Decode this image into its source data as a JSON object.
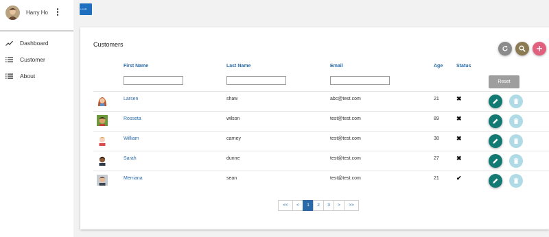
{
  "sidebar": {
    "user_name": "Harry Ho",
    "items": [
      {
        "label": "Dashboard",
        "icon": "trending-up-icon"
      },
      {
        "label": "Customer",
        "icon": "list-icon"
      },
      {
        "label": "About",
        "icon": "list-icon"
      }
    ]
  },
  "logo_text": "e-vendor",
  "card": {
    "title": "Customers",
    "actions": [
      {
        "name": "refresh-button",
        "icon": "refresh-icon",
        "color": "#8a8a8a"
      },
      {
        "name": "search-button",
        "icon": "search-icon",
        "color": "#8c7a52"
      },
      {
        "name": "add-button",
        "icon": "plus-icon",
        "color": "#e0607e"
      }
    ]
  },
  "table": {
    "columns": [
      "First Name",
      "Last Name",
      "Email",
      "Age",
      "Status"
    ],
    "reset_label": "Reset",
    "rows": [
      {
        "first_name": "Larsen",
        "last_name": "shaw",
        "email": "abc@test.com",
        "age": "21",
        "status": "✖"
      },
      {
        "first_name": "Rosseta",
        "last_name": "wilson",
        "email": "test@test.com",
        "age": "89",
        "status": "✖"
      },
      {
        "first_name": "William",
        "last_name": "carney",
        "email": "test@test.com",
        "age": "38",
        "status": "✖"
      },
      {
        "first_name": "Sarah",
        "last_name": "dunne",
        "email": "test@test.com",
        "age": "27",
        "status": "✖"
      },
      {
        "first_name": "Merriana",
        "last_name": "sean",
        "email": "test@test.com",
        "age": "21",
        "status": "✔"
      }
    ]
  },
  "pagination": {
    "first": "<<",
    "prev": "<",
    "pages": [
      "1",
      "2",
      "3"
    ],
    "current": "1",
    "next": ">",
    "last": ">>"
  },
  "colors": {
    "accent": "#2a6aa8",
    "edit": "#127a72",
    "delete": "#b0dbe6"
  }
}
